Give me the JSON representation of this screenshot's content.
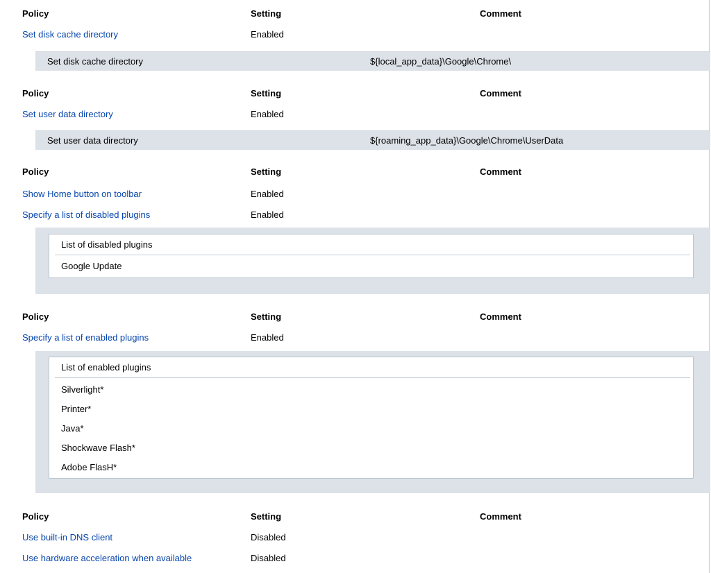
{
  "headers": {
    "policy": "Policy",
    "setting": "Setting",
    "comment": "Comment"
  },
  "sections": [
    {
      "rows": [
        {
          "policy": "Set disk cache directory",
          "setting": "Enabled"
        }
      ],
      "detail": {
        "name": "Set disk cache directory",
        "value": "${local_app_data}\\Google\\Chrome\\"
      }
    },
    {
      "rows": [
        {
          "policy": "Set user data directory",
          "setting": "Enabled"
        }
      ],
      "detail": {
        "name": "Set user data directory",
        "value": "${roaming_app_data}\\Google\\Chrome\\UserData"
      }
    },
    {
      "rows": [
        {
          "policy": "Show Home button on toolbar",
          "setting": "Enabled"
        },
        {
          "policy": "Specify a list of disabled plugins",
          "setting": "Enabled"
        }
      ],
      "list": {
        "title": "List of disabled plugins",
        "items": [
          "Google Update"
        ]
      }
    },
    {
      "rows": [
        {
          "policy": "Specify a list of enabled plugins",
          "setting": "Enabled"
        }
      ],
      "list": {
        "title": "List of enabled plugins",
        "items": [
          "Silverlight*",
          "Printer*",
          "Java*",
          "Shockwave Flash*",
          "Adobe FlasH*"
        ]
      }
    },
    {
      "rows": [
        {
          "policy": "Use built-in DNS client",
          "setting": "Disabled"
        },
        {
          "policy": "Use hardware acceleration when available",
          "setting": "Disabled"
        }
      ]
    }
  ],
  "colors": {
    "link": "#0645ad",
    "panel": "#dce2e8",
    "border": "#b9c3cc"
  }
}
